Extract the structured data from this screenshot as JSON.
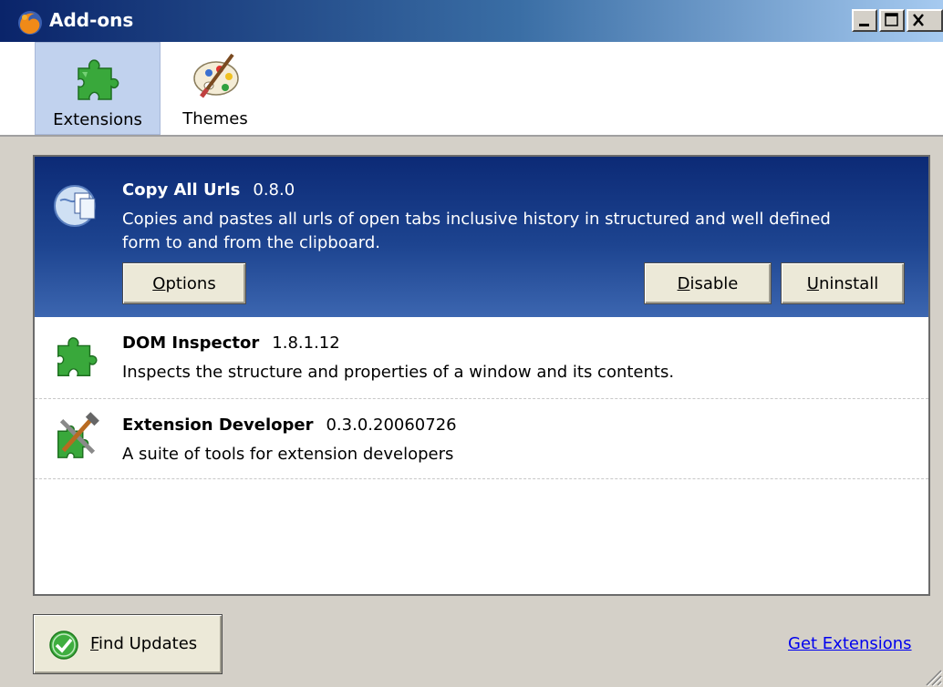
{
  "window": {
    "title": "Add-ons",
    "controls": [
      "minimize",
      "maximize",
      "close"
    ]
  },
  "toolbar": {
    "tabs": [
      {
        "label": "Extensions",
        "icon": "puzzle-piece-icon",
        "selected": true
      },
      {
        "label": "Themes",
        "icon": "palette-icon",
        "selected": false
      }
    ]
  },
  "extensions": [
    {
      "name": "Copy All Urls",
      "version": "0.8.0",
      "description_line1": "Copies and pastes all urls of open tabs inclusive history in structured and well defined",
      "description_line2": "form to and from the clipboard.",
      "icon": "copy-all-urls-icon",
      "selected": true,
      "buttons": {
        "options": {
          "pre": "",
          "key": "O",
          "post": "ptions"
        },
        "disable": {
          "pre": "",
          "key": "D",
          "post": "isable"
        },
        "uninstall": {
          "pre": "",
          "key": "U",
          "post": "ninstall"
        }
      }
    },
    {
      "name": "DOM Inspector",
      "version": "1.8.1.12",
      "description": "Inspects the structure and properties of a window and its contents.",
      "icon": "puzzle-piece-icon"
    },
    {
      "name": "Extension Developer",
      "version": "0.3.0.20060726",
      "description": "A suite of tools for extension developers",
      "icon": "extension-developer-icon"
    }
  ],
  "footer": {
    "find_updates": {
      "key": "F",
      "post": "ind Updates"
    },
    "get_extensions": "Get Extensions"
  },
  "colors": {
    "titlebar": "#0a246a",
    "selected_row": "#1d4490",
    "link": "#0000ee",
    "window_bg": "#d4d0c8"
  }
}
